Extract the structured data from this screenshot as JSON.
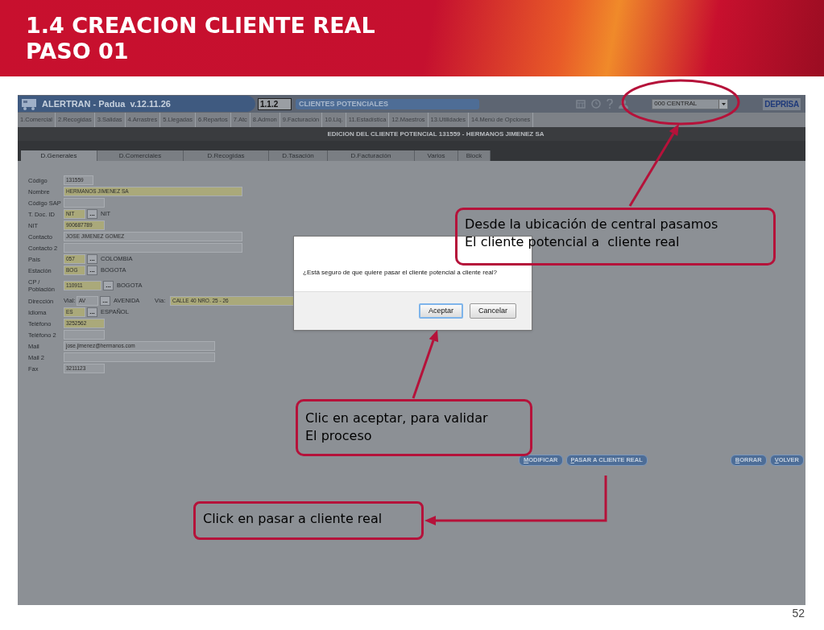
{
  "slide": {
    "title_lines": [
      "1.4 CREACION CLIENTE REAL",
      "PASO 01"
    ],
    "page_number": "52"
  },
  "app": {
    "title": "ALERTRAN - Padua  v.12.11.26",
    "screen_code": "1.1.2",
    "screen_name": "CLIENTES POTENCIALES",
    "branch_select": {
      "value": "000 CENTRAL"
    },
    "logo": "DEPRISA",
    "menu": [
      "1.Comercial",
      "2.Recogidas",
      "3.Salidas",
      "4.Arrastres",
      "5.Llegadas",
      "6.Repartos",
      "7.Atc",
      "8.Admon",
      "9.Facturación",
      "10.Liq.",
      "11.Estadística",
      "12.Maestros",
      "13.Utilidades",
      "14.Menú de Opciones"
    ],
    "edit_title": "EDICION DEL CLIENTE POTENCIAL 131559 - HERMANOS JIMENEZ SA",
    "tabs": [
      {
        "label": "D.Generales",
        "selected": true
      },
      {
        "label": "D.Comerciales",
        "selected": false
      },
      {
        "label": "D.Recogidas",
        "selected": false
      },
      {
        "label": "D.Tasación",
        "selected": false
      },
      {
        "label": "D.Facturación",
        "selected": false
      },
      {
        "label": "Varios",
        "selected": false
      },
      {
        "label": "Block",
        "selected": false
      }
    ],
    "fields": [
      {
        "label": "Código",
        "value": "131559",
        "kind": "plain",
        "required": false
      },
      {
        "label": "Nombre",
        "value": "HERMANOS JIMENEZ SA",
        "kind": "plain",
        "required": true
      },
      {
        "label": "Código SAP",
        "kind": "plain",
        "required": false
      },
      {
        "label": "T. Doc. ID",
        "value": "NIT",
        "kind": "lookup",
        "lookup_button": "...",
        "required": true,
        "description": "NIT"
      },
      {
        "label": "NIT",
        "value": "900687789",
        "kind": "plain",
        "required": true
      },
      {
        "label": "Contacto",
        "value": "JOSE JIMENEZ GOMEZ",
        "kind": "plain",
        "required": false
      },
      {
        "label": "Contacto 2",
        "kind": "plain",
        "required": false
      },
      {
        "label": "País",
        "value": "057",
        "kind": "lookup",
        "lookup_button": "...",
        "required": true,
        "description": "COLOMBIA"
      },
      {
        "label": "Estación",
        "value": "BOG",
        "kind": "lookup",
        "lookup_button": "...",
        "required": true,
        "description": "BOGOTA"
      },
      {
        "label": "CP / Población",
        "value": "110911",
        "kind": "lookup",
        "lookup_button": "...",
        "required": true,
        "description": "BOGOTA"
      },
      {
        "label": "Dirección",
        "kind": "address",
        "vial_label": "Vial:",
        "value": "AV",
        "lookup_button": "...",
        "required": false,
        "description": "AVENIDA",
        "via_label": "Vía:",
        "via_value": "CALLE 40 NRO. 25 - 26",
        "via_required": true
      },
      {
        "label": "Idioma",
        "value": "ES",
        "kind": "lookup",
        "lookup_button": "...",
        "required": true,
        "description": "ESPAÑOL"
      },
      {
        "label": "Teléfono",
        "value": "3252562",
        "kind": "plain",
        "required": true
      },
      {
        "label": "Teléfono 2",
        "kind": "plain",
        "required": false
      },
      {
        "label": "Mail",
        "value": "jose.jimenez@hermanos.com",
        "kind": "plain",
        "required": false
      },
      {
        "label": "Mail 2",
        "kind": "plain",
        "required": false
      },
      {
        "label": "Fax",
        "value": "3211123",
        "kind": "plain",
        "required": false
      }
    ],
    "buttons_left": [
      "MODIFICAR",
      "PASAR A CLIENTE REAL"
    ],
    "buttons_right": [
      "BORRAR",
      "VOLVER"
    ]
  },
  "dialog": {
    "message": "¿Está seguro de que quiere pasar el cliente potencial a cliente real?",
    "buttons": [
      {
        "label": "Aceptar",
        "focused": true
      },
      {
        "label": "Cancelar",
        "focused": false
      }
    ]
  },
  "callouts": [
    {
      "lines": [
        "Desde la ubicación de central pasamos",
        "El cliente potencial a  cliente real"
      ]
    },
    {
      "lines": [
        "Clic en aceptar, para validar",
        "El proceso"
      ]
    },
    {
      "lines": [
        "Click en pasar a cliente real"
      ]
    }
  ]
}
